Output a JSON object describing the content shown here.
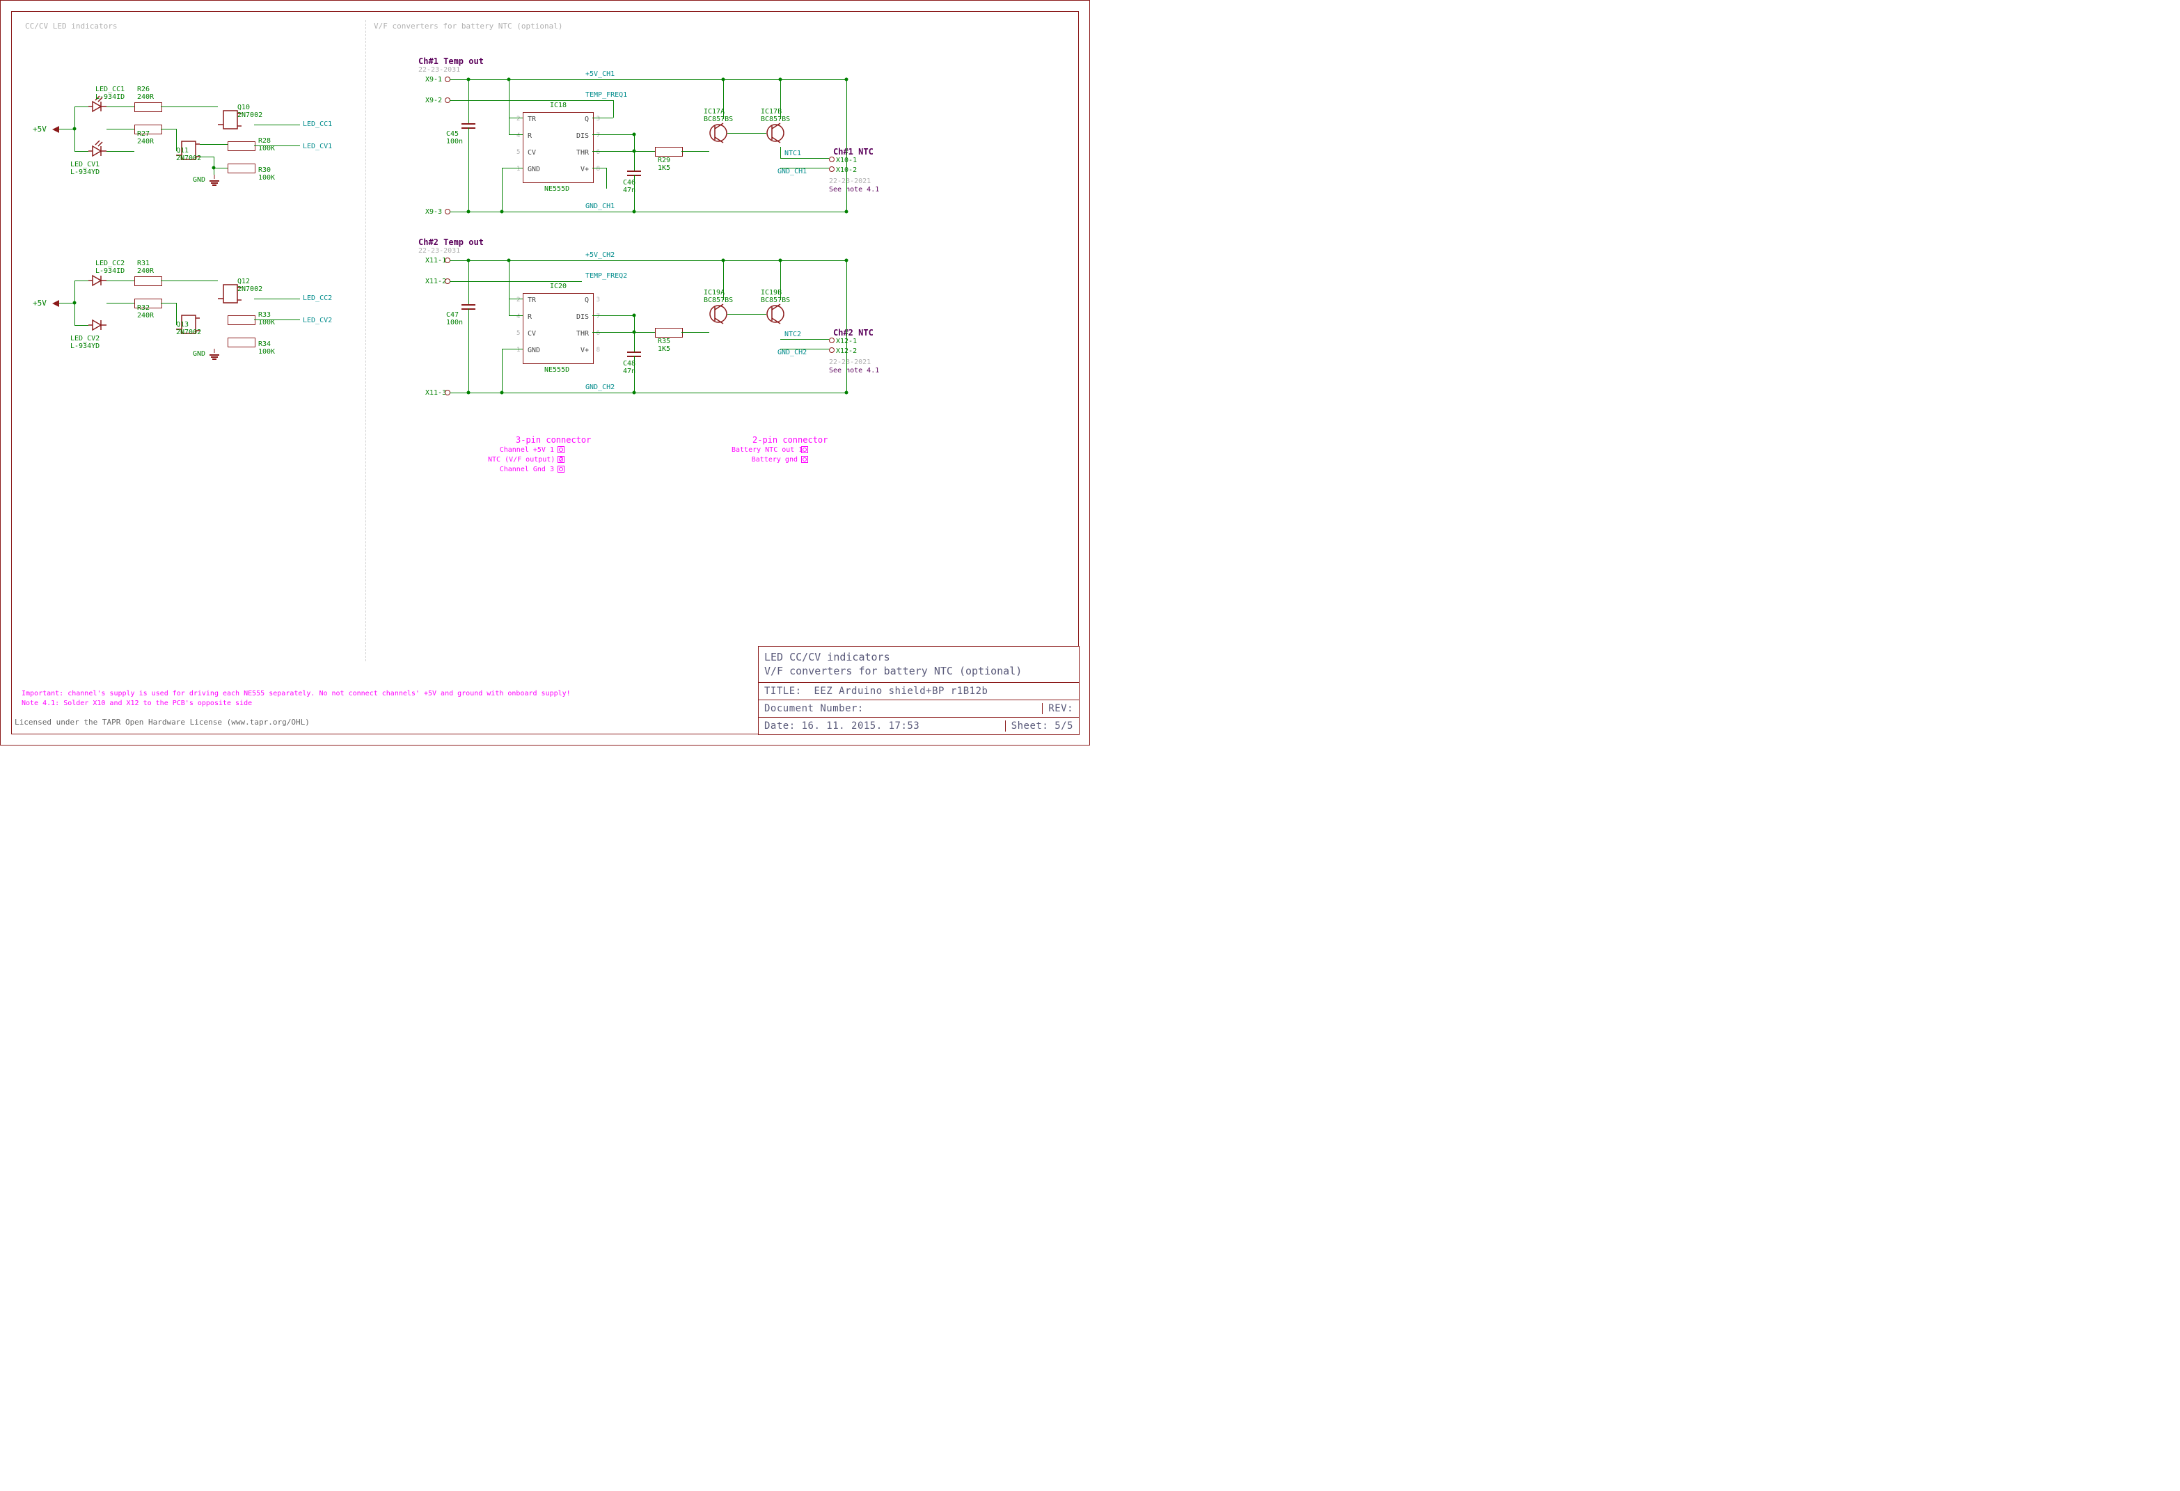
{
  "sections": {
    "left_title": "CC/CV LED indicators",
    "right_title": "V/F converters for battery NTC (optional)"
  },
  "rail": "+5V",
  "gnd": "GND",
  "block1": {
    "led_cc": {
      "name": "LED_CC1",
      "part": "L-934ID"
    },
    "led_cv": {
      "name": "LED_CV1",
      "part": "L-934YD"
    },
    "r_top": {
      "name": "R26",
      "val": "240R"
    },
    "r_bot": {
      "name": "R27",
      "val": "240R"
    },
    "r_g1": {
      "name": "R28",
      "val": "100K"
    },
    "r_g2": {
      "name": "R30",
      "val": "100K"
    },
    "q1": {
      "name": "Q10",
      "part": "2N7002"
    },
    "q2": {
      "name": "Q11",
      "part": "2N7002"
    },
    "net_top": "LED_CC1",
    "net_bot": "LED_CV1"
  },
  "block2": {
    "led_cc": {
      "name": "LED_CC2",
      "part": "L-934ID"
    },
    "led_cv": {
      "name": "LED_CV2",
      "part": "L-934YD"
    },
    "r_top": {
      "name": "R31",
      "val": "240R"
    },
    "r_bot": {
      "name": "R32",
      "val": "240R"
    },
    "r_g1": {
      "name": "R33",
      "val": "100K"
    },
    "r_g2": {
      "name": "R34",
      "val": "100K"
    },
    "q1": {
      "name": "Q12",
      "part": "2N7002"
    },
    "q2": {
      "name": "Q13",
      "part": "2N7002"
    },
    "net_top": "LED_CC2",
    "net_bot": "LED_CV2"
  },
  "vf1": {
    "header": "Ch#1 Temp out",
    "conn": "22-23-2031",
    "pins": [
      "X9-1",
      "X9-2",
      "X9-3"
    ],
    "p5": "+5V_CH1",
    "freq": "TEMP_FREQ1",
    "gnd": "GND_CH1",
    "ic": {
      "name": "IC18",
      "part": "NE555D"
    },
    "c1": {
      "name": "C45",
      "val": "100n"
    },
    "c2": {
      "name": "C46",
      "val": "47n"
    },
    "r": {
      "name": "R29",
      "val": "1K5"
    },
    "qA": {
      "name": "IC17A",
      "part": "BC857BS"
    },
    "qB": {
      "name": "IC17B",
      "part": "BC857BS"
    },
    "ntc_net": "NTC1",
    "ntc_hdr": "Ch#1 NTC",
    "ntc_pins": [
      "X10-1",
      "X10-2"
    ],
    "ntc_conn": "22-23-2021",
    "note": "See note 4.1"
  },
  "vf2": {
    "header": "Ch#2 Temp out",
    "conn": "22-23-2031",
    "pins": [
      "X11-1",
      "X11-2",
      "X11-3"
    ],
    "p5": "+5V_CH2",
    "freq": "TEMP_FREQ2",
    "gnd": "GND_CH2",
    "ic": {
      "name": "IC20",
      "part": "NE555D"
    },
    "c1": {
      "name": "C47",
      "val": "100n"
    },
    "c2": {
      "name": "C48",
      "val": "47n"
    },
    "r": {
      "name": "R35",
      "val": "1K5"
    },
    "qA": {
      "name": "IC19A",
      "part": "BC857BS"
    },
    "qB": {
      "name": "IC19B",
      "part": "BC857BS"
    },
    "ntc_net": "NTC2",
    "ntc_hdr": "Ch#2 NTC",
    "ntc_pins": [
      "X12-1",
      "X12-2"
    ],
    "ntc_conn": "22-23-2021",
    "note": "See note 4.1"
  },
  "ic_pins": {
    "2": "TR",
    "3": "Q",
    "4": "R",
    "7": "DIS",
    "5": "CV",
    "6": "THR",
    "1": "GND",
    "8": "V+"
  },
  "legend3": {
    "title": "3-pin connector",
    "rows": [
      "Channel +5V 1",
      "NTC (V/F output) 2",
      "Channel Gnd 3"
    ]
  },
  "legend2": {
    "title": "2-pin connector",
    "rows": [
      "Battery NTC out 1",
      "Battery gnd"
    ]
  },
  "notes": {
    "important": "Important: channel's supply is used for driving each NE555 separately. No not connect channels' +5V and ground with onboard supply!",
    "n41": "Note 4.1: Solder X10 and X12 to the PCB's opposite side",
    "license": "Licensed under the TAPR Open Hardware License (www.tapr.org/OHL)"
  },
  "titleblock": {
    "line1": "LED CC/CV indicators",
    "line2": "V/F converters for battery NTC (optional)",
    "title_lbl": "TITLE:",
    "title": "EEZ Arduino shield+BP r1B12b",
    "docnum_lbl": "Document Number:",
    "docnum": "",
    "rev_lbl": "REV:",
    "rev": "",
    "date_lbl": "Date:",
    "date": "16. 11. 2015. 17:53",
    "sheet_lbl": "Sheet:",
    "sheet": "5/5"
  }
}
